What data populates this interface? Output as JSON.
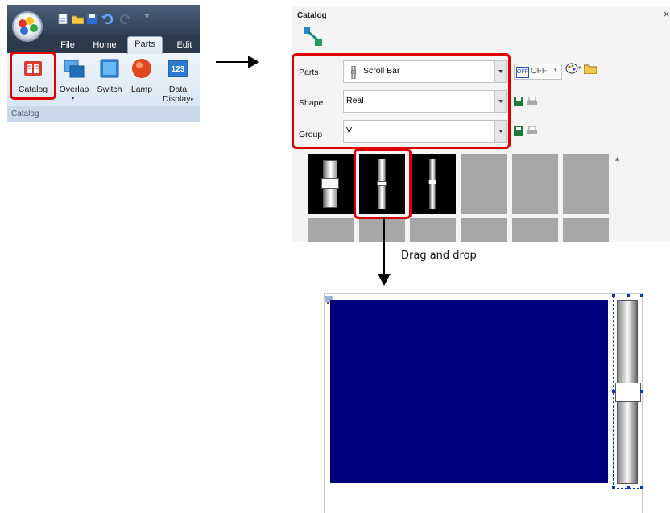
{
  "ribbon": {
    "tabs": [
      "File",
      "Home",
      "Parts",
      "Edit"
    ],
    "active_tab": "Parts",
    "buttons": [
      {
        "label": "Catalog",
        "icon": "catalog-book-icon"
      },
      {
        "label": "Overlap",
        "icon": "overlap-icon"
      },
      {
        "label": "Switch",
        "icon": "switch-icon"
      },
      {
        "label": "Lamp",
        "icon": "lamp-icon"
      },
      {
        "label": "Data",
        "label2": "Display",
        "icon": "data-display-123-icon"
      }
    ],
    "group_label": "Catalog",
    "accent": "#e00000"
  },
  "catalog": {
    "title": "Catalog",
    "close": "×",
    "fields": {
      "parts_label": "Parts",
      "parts_value": "Scroll Bar",
      "shape_label": "Shape",
      "shape_value": "Real",
      "group_label": "Group",
      "group_value": "V"
    },
    "off_button": "OFF",
    "off_badge": "OFF",
    "selected_index": 1
  },
  "annotation": {
    "drag_label": "Drag and drop"
  },
  "canvas": {
    "panel_color": "#00007f",
    "handle_color": "#0a2fd3"
  }
}
